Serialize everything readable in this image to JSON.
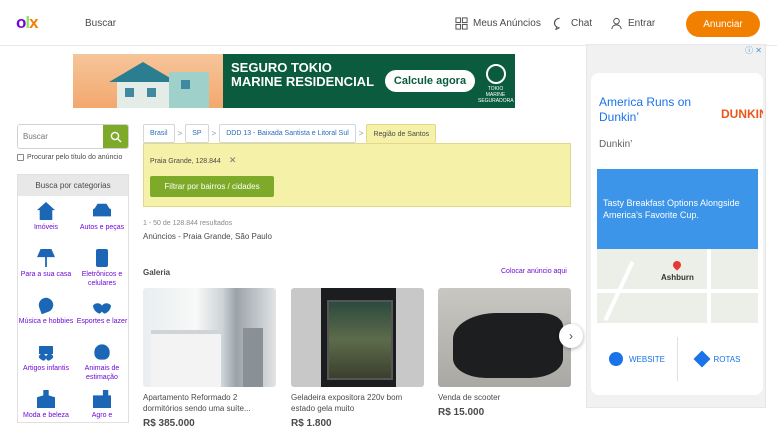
{
  "header": {
    "logo": "OLX",
    "search_link": "Buscar",
    "my_ads": "Meus Anúncios",
    "chat": "Chat",
    "login": "Entrar",
    "post_ad": "Anunciar",
    "accent_color": "#f28000",
    "brand_color": "#6e0ad6"
  },
  "banner_ad": {
    "title": "SEGURO TOKIO MARINE RESIDENCIAL",
    "cta": "Calcule agora",
    "brand": "TOKIO MARINE SEGURADORA"
  },
  "sidebar": {
    "search_placeholder": "Buscar",
    "title_only_label": "Procurar pelo título do anúncio",
    "categories_heading": "Busca por categorias",
    "categories": [
      {
        "label": "Imóveis",
        "icon": "house-icon"
      },
      {
        "label": "Autos e peças",
        "icon": "car-icon"
      },
      {
        "label": "Para a sua casa",
        "icon": "lamp-icon"
      },
      {
        "label": "Eletrônicos e celulares",
        "icon": "phone-icon"
      },
      {
        "label": "Música e hobbies",
        "icon": "guitar-icon"
      },
      {
        "label": "Esportes e lazer",
        "icon": "bike-icon"
      },
      {
        "label": "Artigos infantis",
        "icon": "stroller-icon"
      },
      {
        "label": "Animais de estimação",
        "icon": "paw-icon"
      },
      {
        "label": "Moda e beleza",
        "icon": "person-icon"
      },
      {
        "label": "Agro e",
        "icon": "tractor-icon"
      }
    ]
  },
  "breadcrumb": [
    "Brasil",
    "SP",
    "DDD 13 - Baixada Santista e Litoral Sul",
    "Região de Santos"
  ],
  "filter": {
    "tag": "Praia Grande, 128.844",
    "button": "Filtrar por bairros / cidades"
  },
  "results": {
    "count": "1 - 50 de 128.844 resultados",
    "title": "Anúncios - Praia Grande, São Paulo"
  },
  "gallery": {
    "heading": "Galeria",
    "link": "Colocar anúncio aqui",
    "items": [
      {
        "title": "Apartamento Reformado 2 dormitórios sendo uma suíte...",
        "price": "R$ 385.000"
      },
      {
        "title": "Geladeira expositora 220v bom estado gela muito",
        "price": "R$ 1.800"
      },
      {
        "title": "Venda de scooter",
        "price": "R$ 15.000"
      }
    ]
  },
  "side_ad": {
    "title": "America Runs on Dunkin’",
    "brand": "DUNKIN'",
    "subtitle": "Dunkin’",
    "promo": "Tasty Breakfast Options Alongside America’s Favorite Cup.",
    "map_label": "Ashburn",
    "website": "WEBSITE",
    "directions": "ROTAS"
  }
}
